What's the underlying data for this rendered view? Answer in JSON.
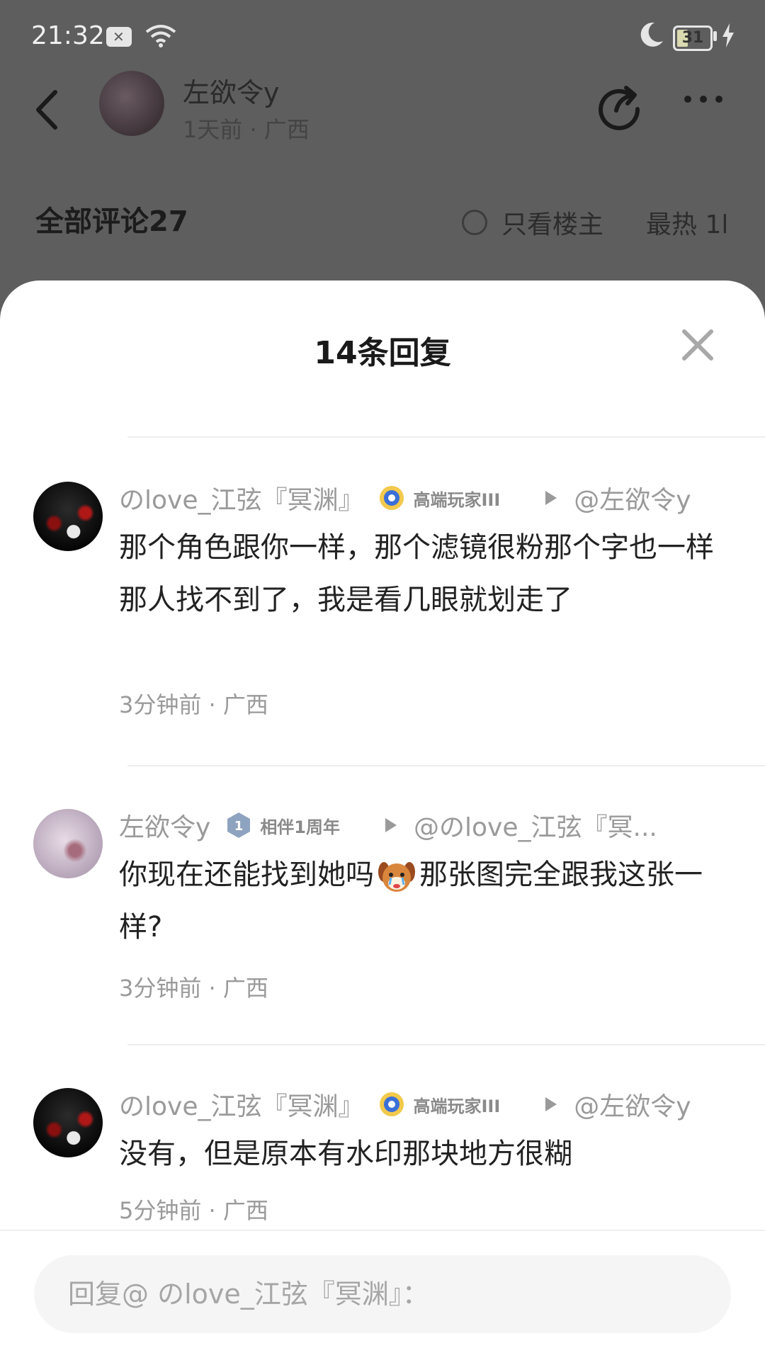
{
  "status_bar": {
    "time": "21:32",
    "battery": "31"
  },
  "header": {
    "author": "左欲令y",
    "meta": "1天前 · 广西"
  },
  "comments_bar": {
    "title": "全部评论27",
    "op_only": "只看楼主",
    "sort": "最热 1l"
  },
  "sheet": {
    "title": "14条回复",
    "replies": [
      {
        "username": "のlove_江弦『冥渊』",
        "badge": "高端玩家III",
        "reply_to": "@左欲令y",
        "lines": [
          "那个角色跟你一样，那个滤镜很粉那个字也一样",
          "那人找不到了，我是看几眼就划走了"
        ],
        "time": "3分钟前 · 广西"
      },
      {
        "username": "左欲令y",
        "badge": "相伴1周年",
        "reply_to": "@のlove_江弦『冥...",
        "text_before": "你现在还能找到她吗",
        "emoji": "crying-dog-emoji",
        "text_after": "那张图完全跟我这张一样?",
        "time": "3分钟前 · 广西"
      },
      {
        "username": "のlove_江弦『冥渊』",
        "badge": "高端玩家III",
        "reply_to": "@左欲令y",
        "lines": [
          "没有，但是原本有水印那块地方很糊"
        ],
        "time": "5分钟前 · 广西"
      }
    ]
  },
  "composer": {
    "placeholder": "回复@ のlove_江弦『冥渊』："
  }
}
